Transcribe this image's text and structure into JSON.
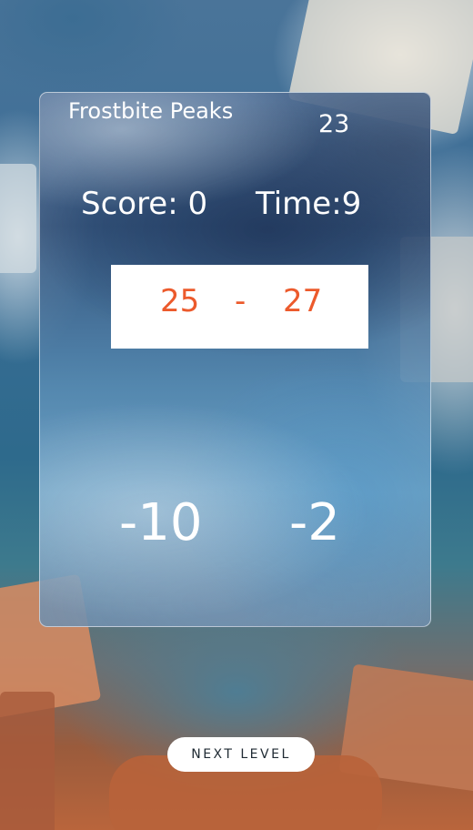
{
  "level": {
    "name": "Frostbite Peaks",
    "number": "23"
  },
  "stats": {
    "score_text": "Score: 0",
    "time_text": "Time:9"
  },
  "range": {
    "low": "25",
    "separator": "-",
    "high": "27",
    "text_color": "#ec5a2c"
  },
  "choices": [
    {
      "label": "-10"
    },
    {
      "label": "-2"
    }
  ],
  "next_button": {
    "label": "NEXT LEVEL"
  }
}
